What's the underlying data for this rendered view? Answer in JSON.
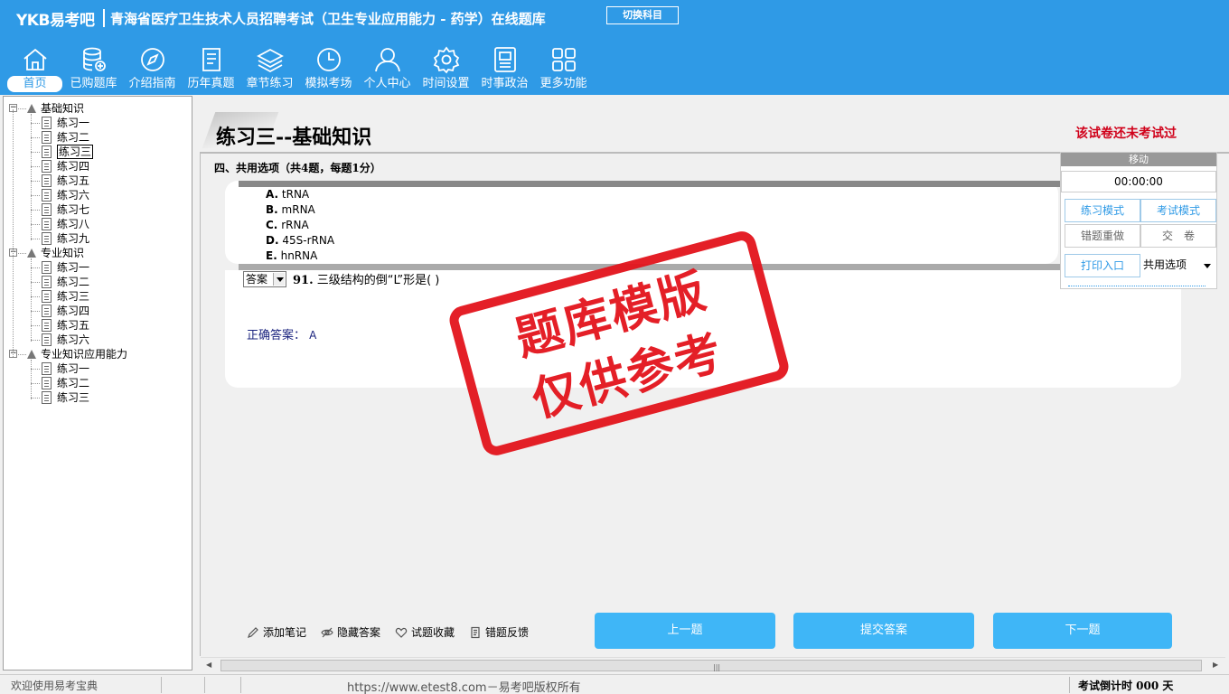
{
  "header": {
    "brand": "YKB易考吧",
    "title": "青海省医疗卫生技术人员招聘考试（卫生专业应用能力 - 药学）在线题库",
    "switch_label": "切换科目"
  },
  "nav": [
    {
      "label": "首页",
      "icon": "home-icon"
    },
    {
      "label": "已购题库",
      "icon": "database-icon"
    },
    {
      "label": "介绍指南",
      "icon": "compass-icon"
    },
    {
      "label": "历年真题",
      "icon": "document-list-icon"
    },
    {
      "label": "章节练习",
      "icon": "layers-icon"
    },
    {
      "label": "模拟考场",
      "icon": "clock-icon"
    },
    {
      "label": "个人中心",
      "icon": "user-icon"
    },
    {
      "label": "时间设置",
      "icon": "gear-icon"
    },
    {
      "label": "时事政治",
      "icon": "newspaper-icon"
    },
    {
      "label": "更多功能",
      "icon": "grid-icon"
    }
  ],
  "tree": {
    "groups": [
      {
        "label": "基础知识",
        "items": [
          "练习一",
          "练习二",
          "练习三",
          "练习四",
          "练习五",
          "练习六",
          "练习七",
          "练习八",
          "练习九"
        ],
        "selected": 2
      },
      {
        "label": "专业知识",
        "items": [
          "练习一",
          "练习二",
          "练习三",
          "练习四",
          "练习五",
          "练习六"
        ]
      },
      {
        "label": "专业知识应用能力",
        "items": [
          "练习一",
          "练习二",
          "练习三"
        ]
      }
    ]
  },
  "main": {
    "section_title": "练习三--基础知识",
    "status": "该试卷还未考试过",
    "group_title": "四、共用选项（共4题，每题1分）",
    "options": [
      {
        "key": "A.",
        "text": "tRNA"
      },
      {
        "key": "B.",
        "text": "mRNA"
      },
      {
        "key": "C.",
        "text": "rRNA"
      },
      {
        "key": "D.",
        "text": "45S-rRNA"
      },
      {
        "key": "E.",
        "text": "hnRNA"
      }
    ],
    "answer_select": "答案",
    "question_number": "91.",
    "question_text": "三级结构的倒“L”形是(  )",
    "correct_label": "正确答案：",
    "correct_value": "A"
  },
  "control": {
    "head": "移动",
    "timer": "00:00:00",
    "practice_mode": "练习模式",
    "exam_mode": "考试模式",
    "redo_wrong": "错题重做",
    "submit_paper": "交　卷",
    "print": "打印入口",
    "option_select": "共用选项"
  },
  "stamp": {
    "line1": "题库模版",
    "line2": "仅供参考"
  },
  "tools": {
    "note": "添加笔记",
    "hide": "隐藏答案",
    "favorite": "试题收藏",
    "feedback": "错题反馈"
  },
  "buttons": {
    "prev": "上一题",
    "submit": "提交答案",
    "next": "下一题"
  },
  "statusbar": {
    "welcome": "欢迎使用易考宝典",
    "copyright": "https://www.etest8.com－易考吧版权所有",
    "countdown": "考试倒计时 000 天"
  },
  "colors": {
    "header": "#2f9ae6",
    "accent_button": "#3fb6f7",
    "stamp": "#e3141c",
    "status": "#d0021b"
  }
}
